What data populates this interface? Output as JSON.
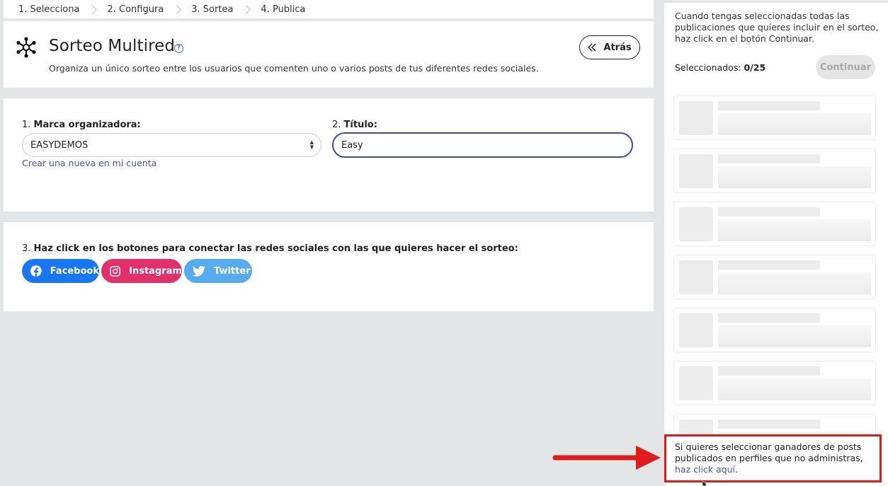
{
  "steps": [
    {
      "label": "1. Selecciona"
    },
    {
      "label": "2. Configura"
    },
    {
      "label": "3. Sortea"
    },
    {
      "label": "4. Publica"
    }
  ],
  "header": {
    "title": "Sorteo Multired",
    "subtitle": "Organiza un único sorteo entre los usuarios que comenten uno o varios posts de tus diferentes redes sociales.",
    "back_label": "Atrás",
    "help_glyph": "?"
  },
  "form": {
    "brand_num": "1.",
    "brand_label": "Marca organizadora:",
    "brand_value": "EASYDEMOS",
    "title_num": "2.",
    "title_label": "Título:",
    "title_value": "Easy",
    "create_link": "Crear una nueva en mi cuenta"
  },
  "social": {
    "label_num": "3.",
    "label": "Haz click en los botones para conectar las redes sociales con las que quieres hacer el sorteo:",
    "buttons": [
      {
        "label": "Facebook",
        "icon": "facebook-icon",
        "color": "#1877f2"
      },
      {
        "label": "Instagram",
        "icon": "instagram-icon",
        "color": "#e1306c"
      },
      {
        "label": "Twitter",
        "icon": "twitter-icon",
        "color": "#55acee"
      }
    ]
  },
  "sidebar": {
    "instructions": "Cuando tengas seleccionadas todas las publicaciones que quieres incluir en el sorteo, haz click en el botón Continuar.",
    "selected_label": "Seleccionados:",
    "selected_count": "0/25",
    "continue_label": "Continuar",
    "note_text": "Si quieres seleccionar ganadores de posts publicados en perfiles que no administras,",
    "note_link": "haz click aquí",
    "note_end": "."
  },
  "colors": {
    "accent": "#3d4aa8",
    "link": "#4450b8",
    "highlight": "#e21a1a",
    "background": "#e4e5e7"
  }
}
